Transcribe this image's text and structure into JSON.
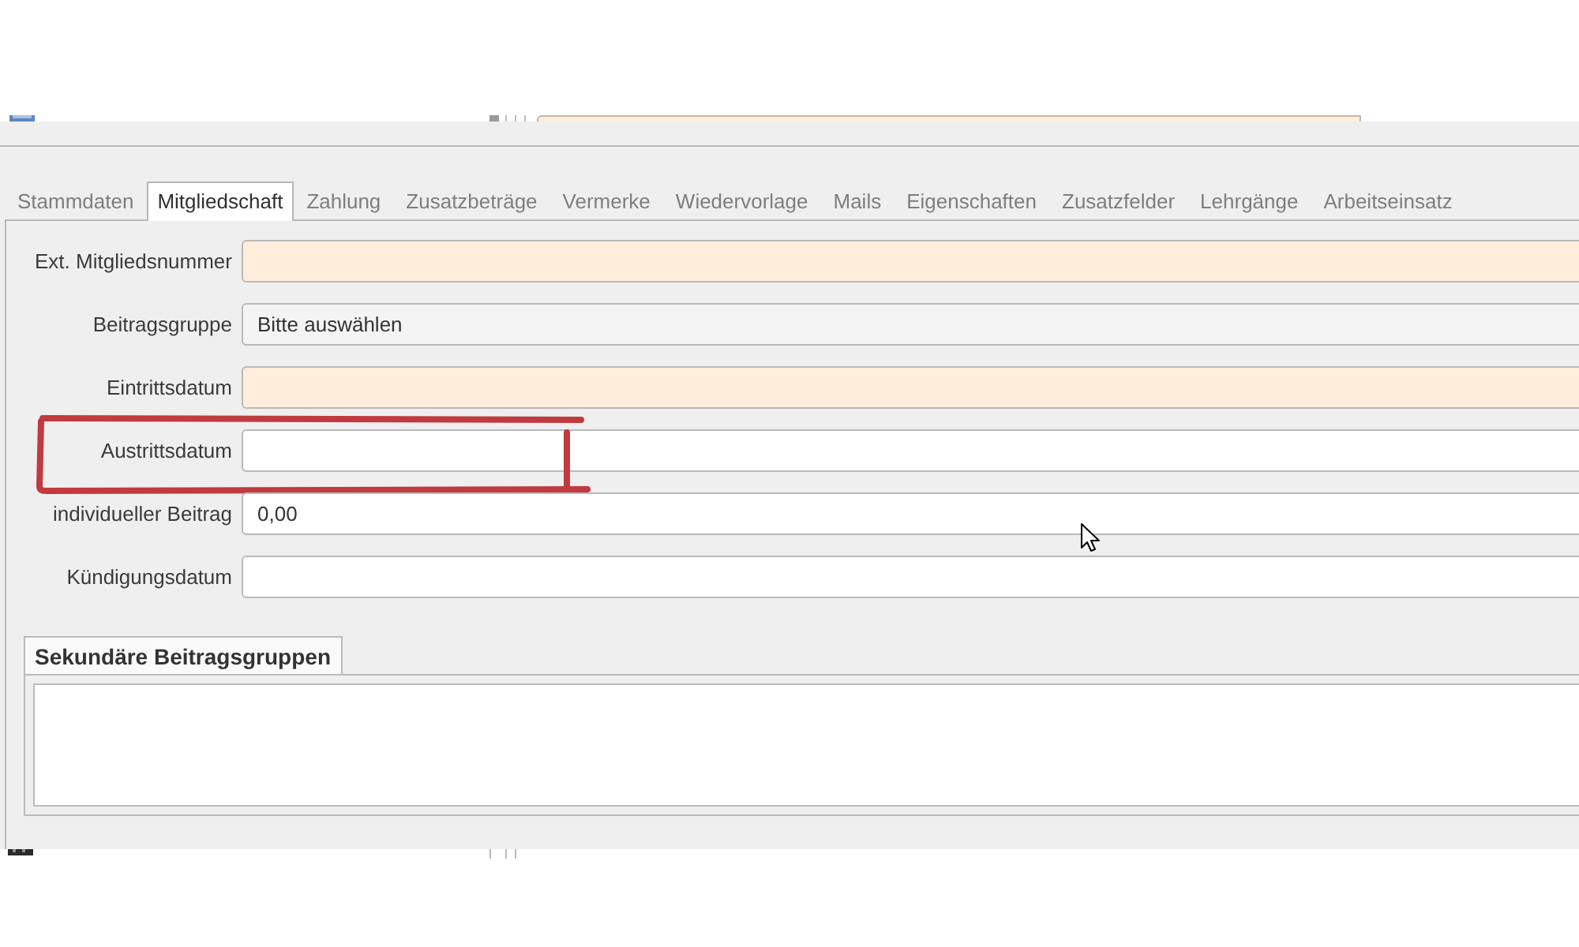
{
  "tabs": [
    {
      "label": "Stammdaten",
      "selected": false
    },
    {
      "label": "Mitgliedschaft",
      "selected": true
    },
    {
      "label": "Zahlung",
      "selected": false
    },
    {
      "label": "Zusatzbeträge",
      "selected": false
    },
    {
      "label": "Vermerke",
      "selected": false
    },
    {
      "label": "Wiedervorlage",
      "selected": false
    },
    {
      "label": "Mails",
      "selected": false
    },
    {
      "label": "Eigenschaften",
      "selected": false
    },
    {
      "label": "Zusatzfelder",
      "selected": false
    },
    {
      "label": "Lehrgänge",
      "selected": false
    },
    {
      "label": "Arbeitseinsatz",
      "selected": false
    }
  ],
  "fields": [
    {
      "label": "Ext. Mitgliedsnummer",
      "kind": "text",
      "required": true,
      "highlighted": false
    },
    {
      "label": "Beitragsgruppe",
      "kind": "combo",
      "value": "Bitte auswählen",
      "required": false,
      "highlighted": false
    },
    {
      "label": "Eintrittsdatum",
      "kind": "text",
      "required": true,
      "highlighted": false
    },
    {
      "label": "Austrittsdatum",
      "kind": "text",
      "required": false,
      "highlighted": true
    },
    {
      "label": "individueller Beitrag",
      "kind": "text",
      "value": "0,00",
      "required": false,
      "highlighted": false
    },
    {
      "label": "Kündigungsdatum",
      "kind": "text",
      "required": false,
      "highlighted": false
    }
  ],
  "secondary_groups": {
    "title": "Sekundäre Beitragsgruppen"
  }
}
